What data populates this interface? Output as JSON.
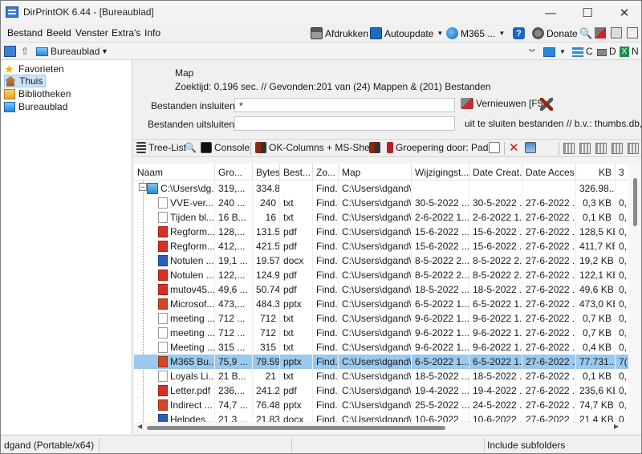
{
  "window": {
    "title": "DirPrintOK 6.44 - [Bureaublad]",
    "controls": {
      "minimize": "—",
      "maximize": "☐",
      "close": "✕"
    }
  },
  "menu": [
    "Bestand",
    "Beeld",
    "Venster",
    "Extra's",
    "Info"
  ],
  "toolbar": {
    "print": "Afdrukken",
    "autoupdate": "Autoupdate",
    "m365": "M365 ...",
    "help": "?",
    "donate": "Donate",
    "drive_c": "C",
    "drive_d": "D",
    "drive_n": "N"
  },
  "address": {
    "location": "Bureaublad"
  },
  "tree": {
    "items": [
      {
        "label": "Favorieten",
        "icon": "star-icon"
      },
      {
        "label": "Thuis",
        "icon": "home-icon",
        "selected": true
      },
      {
        "label": "Bibliotheken",
        "icon": "library-icon"
      },
      {
        "label": "Bureaublad",
        "icon": "desktop-icon"
      }
    ]
  },
  "info": {
    "map_label": "Map",
    "stats": "Zoektijd: 0,196 sec. //  Gevonden:201 van (24) Mappen & (201) Bestanden",
    "include_label": "Bestanden insluiten",
    "include_value": "*",
    "exclude_label": "Bestanden uitsluiten",
    "exclude_value": "",
    "refresh": "Vernieuwen [F5]",
    "exclude_hint": "uit te sluiten bestanden // b.v.: thumbs.db,*."
  },
  "toolbar2": {
    "treelist": "Tree-List",
    "console": "Console",
    "okcolumns": "OK-Columns + MS-Shell",
    "grouping": "Groepering door: Pad"
  },
  "table": {
    "columns": [
      {
        "label": "Naam"
      },
      {
        "label": "Gro..."
      },
      {
        "label": "Bytes",
        "align": "right"
      },
      {
        "label": "Best..."
      },
      {
        "label": "Zo..."
      },
      {
        "label": "Map"
      },
      {
        "label": "Wijzigingst..."
      },
      {
        "label": "Date Creat..."
      },
      {
        "label": "Date Acces..."
      },
      {
        "label": "KB",
        "align": "right"
      },
      {
        "label": "3"
      }
    ],
    "rows": [
      {
        "type": "folder",
        "cells": [
          "C:\\Users\\dg...",
          "319,...",
          "334.83...",
          "",
          "Find...",
          "C:\\Users\\dgand\\...",
          "",
          "",
          "",
          "326.98...",
          ""
        ]
      },
      {
        "type": "txt",
        "cells": [
          "VVE-ver...",
          "240 ...",
          "240",
          "txt",
          "Find...",
          "C:\\Users\\dgand\\...",
          "30-5-2022 ...",
          "30-5-2022 ...",
          "27-6-2022 ...",
          "0,3 KB",
          "0,"
        ]
      },
      {
        "type": "txt",
        "cells": [
          "Tijden bl...",
          "16 B...",
          "16",
          "txt",
          "Find...",
          "C:\\Users\\dgand\\...",
          "2-6-2022 1...",
          "2-6-2022 1...",
          "27-6-2022 ...",
          "0,1 KB",
          "0,"
        ]
      },
      {
        "type": "pdf",
        "cells": [
          "Regform...",
          "128,...",
          "131.550",
          "pdf",
          "Find...",
          "C:\\Users\\dgand\\...",
          "15-6-2022 ...",
          "15-6-2022 ...",
          "27-6-2022 ...",
          "128,5 KB",
          "0,"
        ]
      },
      {
        "type": "pdf",
        "cells": [
          "Regform...",
          "412,...",
          "421.518",
          "pdf",
          "Find...",
          "C:\\Users\\dgand\\...",
          "15-6-2022 ...",
          "15-6-2022 ...",
          "27-6-2022 ...",
          "411,7 KB",
          "0,"
        ]
      },
      {
        "type": "docx",
        "cells": [
          "Notulen ...",
          "19,1 ...",
          "19.579",
          "docx",
          "Find...",
          "C:\\Users\\dgand\\...",
          "8-5-2022 2...",
          "8-5-2022 2...",
          "27-6-2022 ...",
          "19,2 KB",
          "0,"
        ]
      },
      {
        "type": "pdf",
        "cells": [
          "Notulen ...",
          "122,...",
          "124.982",
          "pdf",
          "Find...",
          "C:\\Users\\dgand\\...",
          "8-5-2022 2...",
          "8-5-2022 2...",
          "27-6-2022 ...",
          "122,1 KB",
          "0,"
        ]
      },
      {
        "type": "pdf",
        "cells": [
          "mutov45...",
          "49,6 ...",
          "50.746",
          "pdf",
          "Find...",
          "C:\\Users\\dgand\\...",
          "18-5-2022 ...",
          "18-5-2022 ...",
          "27-6-2022 ...",
          "49,6 KB",
          "0,"
        ]
      },
      {
        "type": "pptx",
        "cells": [
          "Microsof...",
          "473,...",
          "484.313",
          "pptx",
          "Find...",
          "C:\\Users\\dgand\\...",
          "6-5-2022 1...",
          "6-5-2022 1...",
          "27-6-2022 ...",
          "473,0 KB",
          "0,"
        ]
      },
      {
        "type": "txt",
        "cells": [
          "meeting ...",
          "712 ...",
          "712",
          "txt",
          "Find...",
          "C:\\Users\\dgand\\...",
          "9-6-2022 1...",
          "9-6-2022 1...",
          "27-6-2022 ...",
          "0,7 KB",
          "0,"
        ]
      },
      {
        "type": "txt",
        "cells": [
          "meeting ...",
          "712 ...",
          "712",
          "txt",
          "Find...",
          "C:\\Users\\dgand\\...",
          "9-6-2022 1...",
          "9-6-2022 1...",
          "27-6-2022 ...",
          "0,7 KB",
          "0,"
        ]
      },
      {
        "type": "txt",
        "cells": [
          "Meeting ...",
          "315 ...",
          "315",
          "txt",
          "Find...",
          "C:\\Users\\dgand\\...",
          "9-6-2022 1...",
          "9-6-2022 1...",
          "27-6-2022 ...",
          "0,4 KB",
          "0,"
        ]
      },
      {
        "type": "pptx",
        "selected": true,
        "cells": [
          "M365 Bu...",
          "75,9 ...",
          "79.597...",
          "pptx",
          "Find...",
          "C:\\Users\\dgand\\...",
          "6-5-2022 1...",
          "6-5-2022 1...",
          "27-6-2022 ...",
          "77.731...",
          "7("
        ]
      },
      {
        "type": "txt",
        "cells": [
          "Loyals Li...",
          "21 B...",
          "21",
          "txt",
          "Find...",
          "C:\\Users\\dgand\\...",
          "18-5-2022 ...",
          "18-5-2022 ...",
          "27-6-2022 ...",
          "0,1 KB",
          "0,"
        ]
      },
      {
        "type": "pdf",
        "cells": [
          "Letter.pdf",
          "236,...",
          "241.217",
          "pdf",
          "Find...",
          "C:\\Users\\dgand\\...",
          "19-4-2022 ...",
          "19-4-2022 ...",
          "27-6-2022 ...",
          "235,6 KB",
          "0,"
        ]
      },
      {
        "type": "pptx",
        "cells": [
          "Indirect ...",
          "74,7 ...",
          "76.486",
          "pptx",
          "Find...",
          "C:\\Users\\dgand\\...",
          "25-5-2022 ...",
          "24-5-2022 ...",
          "27-6-2022 ...",
          "74,7 KB",
          "0,"
        ]
      },
      {
        "type": "docx",
        "cells": [
          "Helpdes...",
          "21,3 ...",
          "21.834",
          "docx",
          "Find...",
          "C:\\Users\\dgand\\...",
          "10-6-2022 ...",
          "10-6-2022 ...",
          "27-6-2022 ...",
          "21,4 KB",
          "0,"
        ]
      }
    ]
  },
  "status": {
    "left": "dgand (Portable/x64)",
    "right": "Include subfolders"
  }
}
